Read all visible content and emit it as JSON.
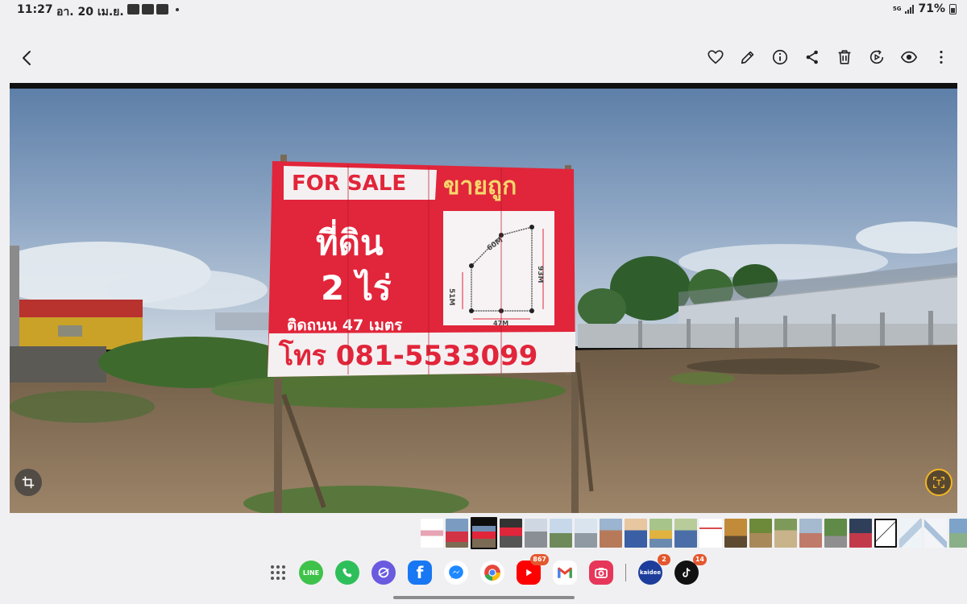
{
  "status_bar": {
    "time": "11:27",
    "date": "อา. 20 เม.ย.",
    "network": "5G",
    "battery": "71%"
  },
  "toolbar": {
    "icons": [
      "back-icon",
      "heart-icon",
      "edit-icon",
      "info-icon",
      "share-icon",
      "delete-icon",
      "remaster-icon",
      "view-icon",
      "more-icon"
    ]
  },
  "photo": {
    "sign": {
      "for_sale": "FOR SALE",
      "cheap": "ขายถูก",
      "land": "ที่ดิน",
      "size": "2 ไร่",
      "frontage": "ติดถนน 47 เมตร",
      "phone": "โทร 081-5533099",
      "dims": {
        "top": "60M",
        "right": "93M",
        "left": "51M",
        "bottom": "47M"
      }
    }
  },
  "filmstrip": {
    "count": 22,
    "active_index": 2
  },
  "dock": {
    "apps": [
      {
        "name": "LINE",
        "label": "LINE",
        "color": "#3fc24a"
      },
      {
        "name": "Phone",
        "label": "",
        "color": "#2fbf5a"
      },
      {
        "name": "Internet",
        "label": "",
        "color": "#6a5ae0"
      },
      {
        "name": "Facebook",
        "label": "f",
        "color": "#1877f2"
      },
      {
        "name": "Messenger",
        "label": "",
        "color": "#ffffff"
      },
      {
        "name": "Chrome",
        "label": "",
        "color": "#ffffff"
      },
      {
        "name": "YouTube",
        "label": "",
        "color": "#ff0000",
        "badge": "867"
      },
      {
        "name": "Gmail",
        "label": "M",
        "color": "#ffffff"
      },
      {
        "name": "Camera",
        "label": "",
        "color": "#e6375a"
      },
      {
        "name": "Kaidee",
        "label": "kaidee",
        "color": "#1d3d9c",
        "badge": "2"
      },
      {
        "name": "TikTok",
        "label": "",
        "color": "#111111",
        "badge": "14"
      }
    ]
  }
}
